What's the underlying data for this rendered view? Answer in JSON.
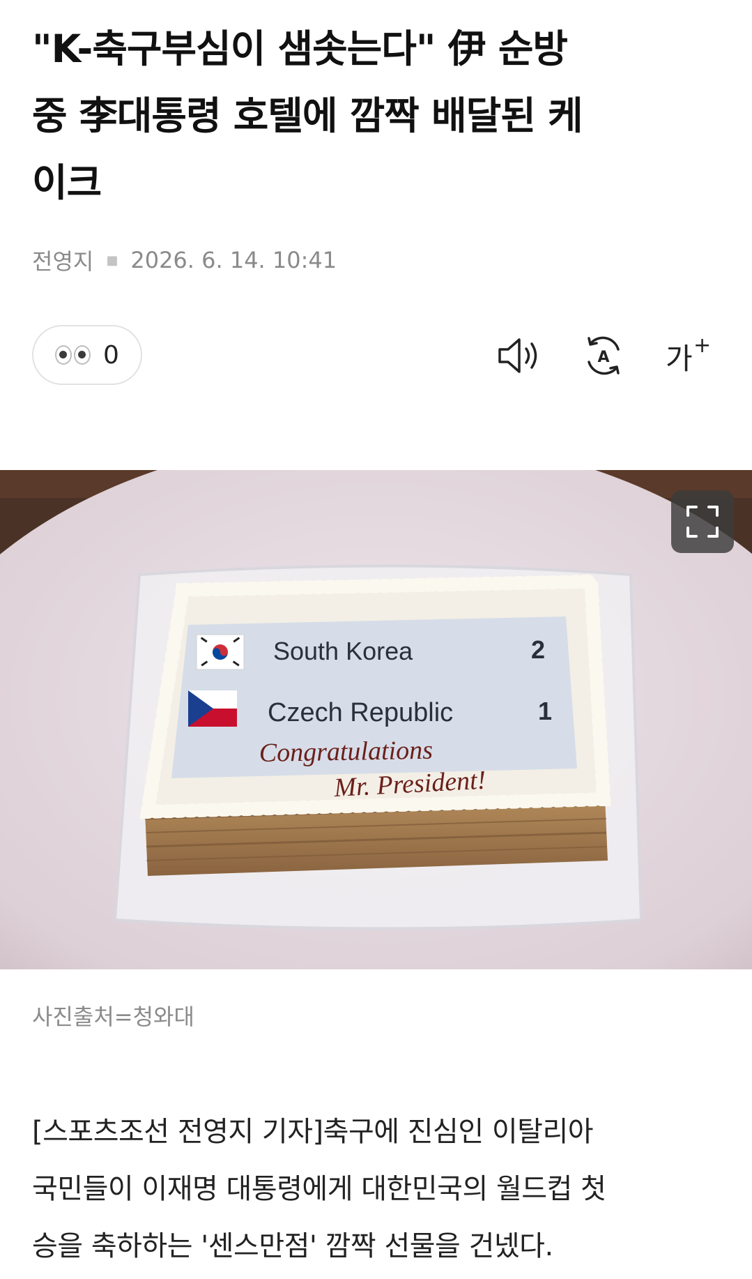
{
  "article": {
    "headline_lines": [
      "\"K-축구부심이 샘솟는다\" 伊 순방",
      "중 李대통령 호텔에 깜짝 배달된 케",
      "이크"
    ],
    "author": "전영지",
    "datetime": "2026. 6. 14. 10:41",
    "reaction_count": "0",
    "font_size_label": "가",
    "font_size_plus": "+",
    "translate_letter": "A"
  },
  "photo": {
    "cake_rows": [
      {
        "team": "South Korea",
        "score": "2",
        "flag": "south-korea-flag"
      },
      {
        "team": "Czech Republic",
        "score": "1",
        "flag": "czech-flag"
      }
    ],
    "handwriting_line1": "Congratulations",
    "handwriting_line2": "Mr. President!",
    "caption": "사진출처=청와대"
  },
  "body": {
    "lines": [
      "[스포츠조선 전영지 기자]축구에 진심인 이탈리아",
      "국민들이 이재명 대통령에게 대한민국의 월드컵 첫",
      "승을 축하하는 '센스만점' 깜짝 선물을 건넸다."
    ]
  },
  "colors": {
    "accent_gray": "#8a8a8a",
    "cake_board": "#d6dde8",
    "czech_blue": "#1b3f8f",
    "czech_red": "#c8102e",
    "korea_red": "#cd2e3a",
    "korea_blue": "#0047a0"
  },
  "icons": [
    "eyes-emoji-icon",
    "speaker-icon",
    "translate-icon",
    "font-size-icon",
    "expand-icon"
  ]
}
